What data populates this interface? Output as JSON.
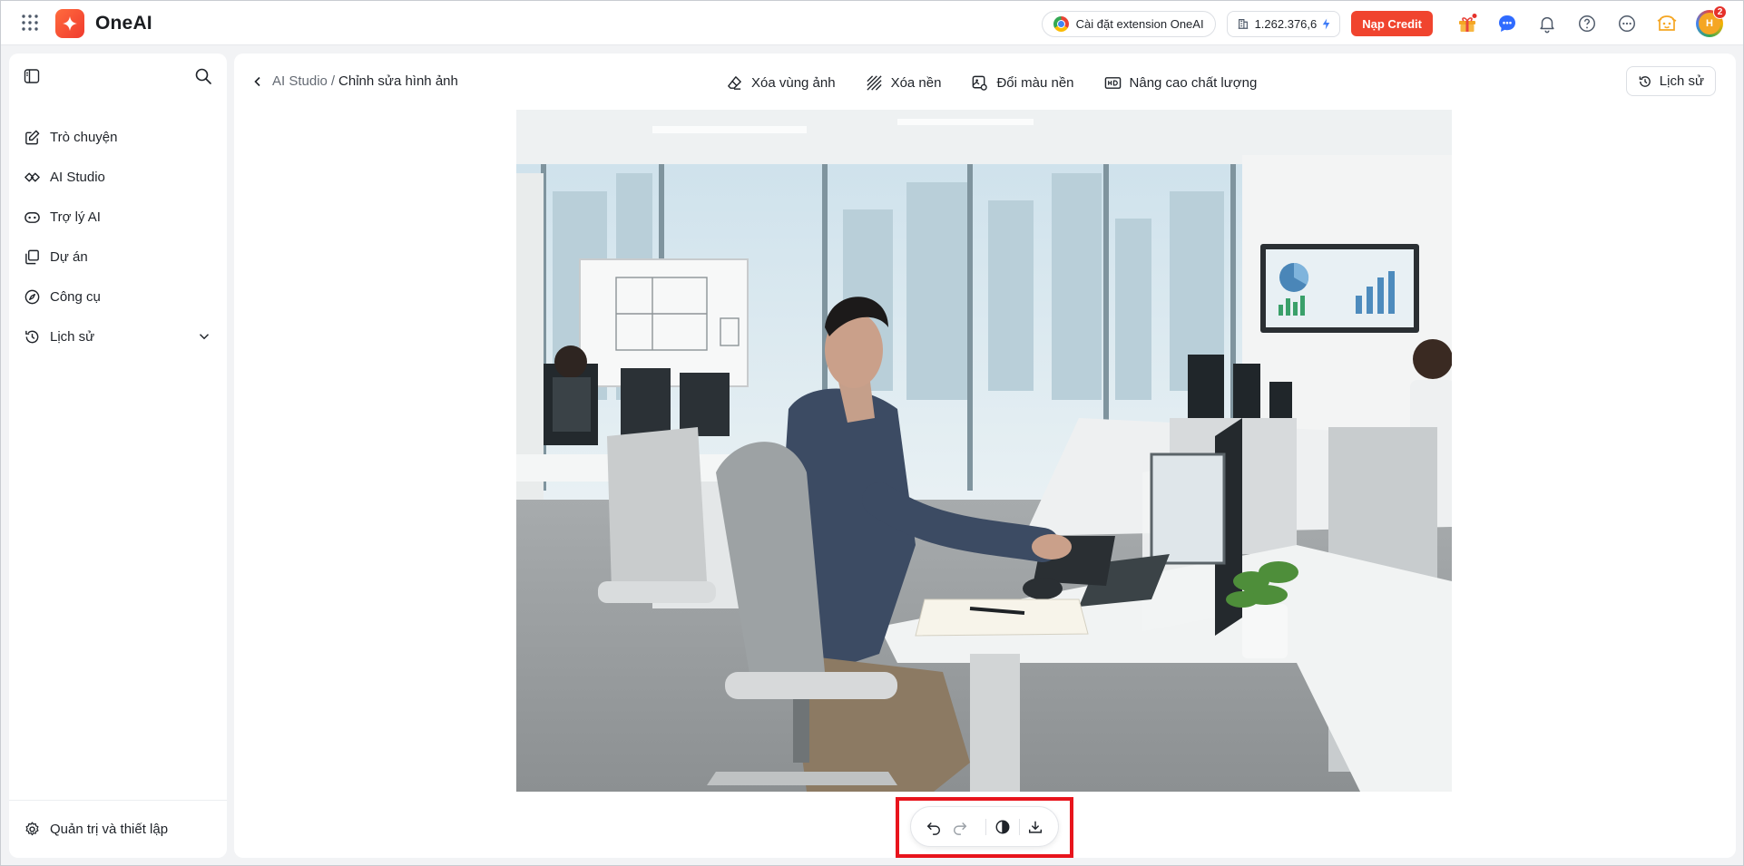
{
  "app": {
    "name": "OneAI",
    "accent": "#f0442e"
  },
  "topbar": {
    "extension_label": "Cài đặt extension OneAI",
    "credit_value": "1.262.376,6",
    "topup_label": "Nạp Credit",
    "avatar_initials": "H",
    "notification_count": "2",
    "icons": [
      "apps-grid-icon",
      "gift-icon",
      "chat-icon",
      "bell-icon",
      "help-icon",
      "more-icon",
      "mascot-icon"
    ]
  },
  "sidebar": {
    "items": [
      {
        "label": "Trò chuyện",
        "icon": "chat-edit-icon"
      },
      {
        "label": "AI Studio",
        "icon": "ai-studio-icon"
      },
      {
        "label": "Trợ lý AI",
        "icon": "bot-icon"
      },
      {
        "label": "Dự án",
        "icon": "folder-icon"
      },
      {
        "label": "Công cụ",
        "icon": "compass-icon"
      },
      {
        "label": "Lịch sử",
        "icon": "history-icon"
      }
    ],
    "settings_label": "Quản trị và thiết lập"
  },
  "main": {
    "breadcrumb": {
      "parent": "AI Studio",
      "separator": "/",
      "current": "Chỉnh sửa hình ảnh"
    },
    "tools": [
      {
        "label": "Xóa vùng ảnh",
        "icon": "eraser-icon"
      },
      {
        "label": "Xóa nền",
        "icon": "hatch-icon"
      },
      {
        "label": "Đổi màu nền",
        "icon": "recolor-icon"
      },
      {
        "label": "Nâng cao chất lượng",
        "icon": "hd-icon"
      }
    ],
    "history_label": "Lịch sử",
    "image": {
      "description": "Office photo"
    },
    "actions": [
      {
        "name": "undo",
        "icon": "undo-icon"
      },
      {
        "name": "redo",
        "icon": "redo-icon"
      },
      {
        "name": "compare",
        "icon": "contrast-icon"
      },
      {
        "name": "download",
        "icon": "download-icon"
      }
    ]
  }
}
